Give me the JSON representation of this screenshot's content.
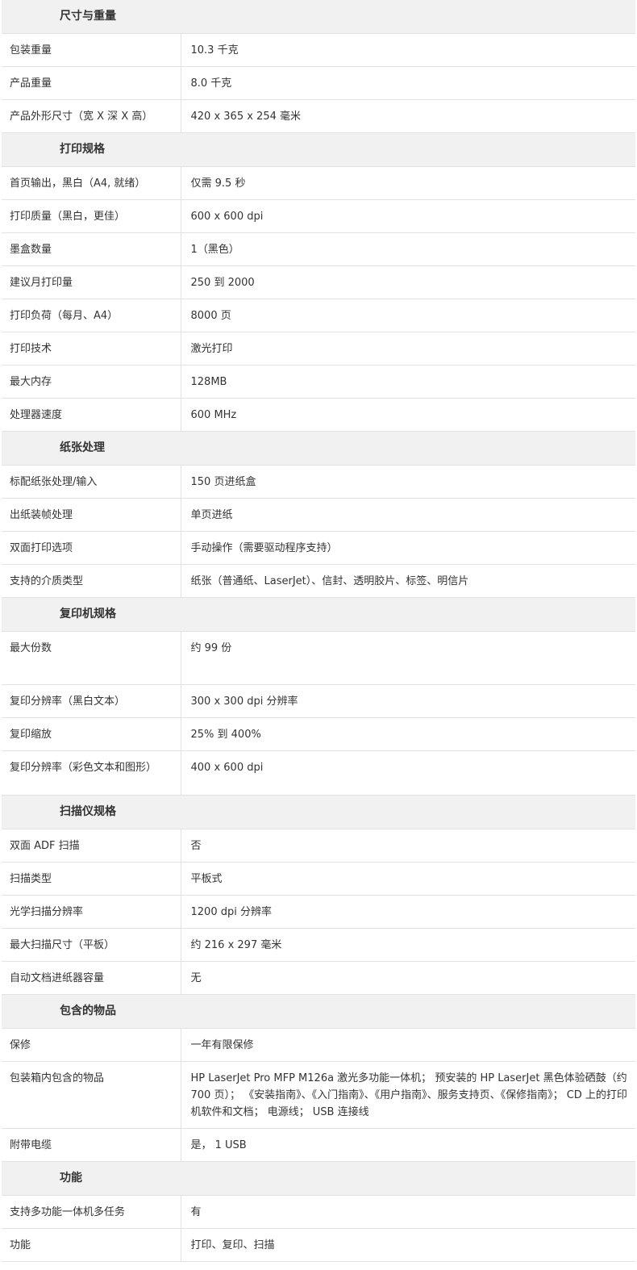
{
  "sections": [
    {
      "title": "尺寸与重量",
      "rows": [
        {
          "label": "包装重量",
          "value": "10.3 千克"
        },
        {
          "label": "产品重量",
          "value": "8.0 千克"
        },
        {
          "label": "产品外形尺寸（宽 X 深 X 高）",
          "value": "420 x 365 x 254 毫米"
        }
      ]
    },
    {
      "title": "打印规格",
      "rows": [
        {
          "label": "首页输出，黑白（A4, 就绪）",
          "value": "仅需 9.5 秒"
        },
        {
          "label": "打印质量（黑白，更佳）",
          "value": " 600 x 600 dpi"
        },
        {
          "label": "墨盒数量",
          "value": "1（黑色）"
        },
        {
          "label": "建议月打印量",
          "value": "250 到 2000"
        },
        {
          "label": "打印负荷（每月、A4）",
          "value": " 8000 页"
        },
        {
          "label": "打印技术",
          "value": "激光打印"
        },
        {
          "label": "最大内存",
          "value": "128MB"
        },
        {
          "label": "处理器速度",
          "value": "600 MHz"
        }
      ]
    },
    {
      "title": "纸张处理",
      "rows": [
        {
          "label": "标配纸张处理/输入",
          "value": "150 页进纸盒"
        },
        {
          "label": "出纸装帧处理",
          "value": "单页进纸"
        },
        {
          "label": "双面打印选项",
          "value": "手动操作（需要驱动程序支持）"
        },
        {
          "label": "支持的介质类型",
          "value": "纸张（普通纸、LaserJet）、信封、透明胶片、标签、明信片"
        }
      ]
    },
    {
      "title": "复印机规格",
      "rows": [
        {
          "label": "最大份数",
          "value": "约 99 份"
        },
        {
          "label": "复印分辨率（黑白文本）",
          "value": "300 x 300 dpi 分辨率"
        },
        {
          "label": "复印缩放",
          "value": "25% 到 400%"
        },
        {
          "label": "复印分辨率（彩色文本和图形）",
          "value": "400 x 600 dpi"
        }
      ]
    },
    {
      "title": "扫描仪规格",
      "rows": [
        {
          "label": "双面 ADF 扫描",
          "value": "否"
        },
        {
          "label": "扫描类型",
          "value": "平板式"
        },
        {
          "label": "光学扫描分辨率",
          "value": "1200 dpi 分辨率"
        },
        {
          "label": "最大扫描尺寸（平板）",
          "value": "约 216 x 297 毫米"
        },
        {
          "label": "自动文档进纸器容量",
          "value": "无"
        }
      ]
    },
    {
      "title": "包含的物品",
      "rows": [
        {
          "label": "保修",
          "value": "一年有限保修"
        },
        {
          "label": "包装箱内包含的物品",
          "value": "HP LaserJet Pro MFP M126a 激光多功能一体机； 预安装的 HP LaserJet 黑色体验硒鼓（约 700 页）； 《安装指南》、《入门指南》、《用户指南》、服务支持页、《保修指南》； CD 上的打印机软件和文档； 电源线； USB 连接线"
        },
        {
          "label": "附带电缆",
          "value": "是， 1 USB"
        }
      ]
    },
    {
      "title": "功能",
      "rows": [
        {
          "label": "支持多功能一体机多任务",
          "value": "有"
        },
        {
          "label": "功能",
          "value": "打印、复印、扫描"
        }
      ]
    }
  ]
}
